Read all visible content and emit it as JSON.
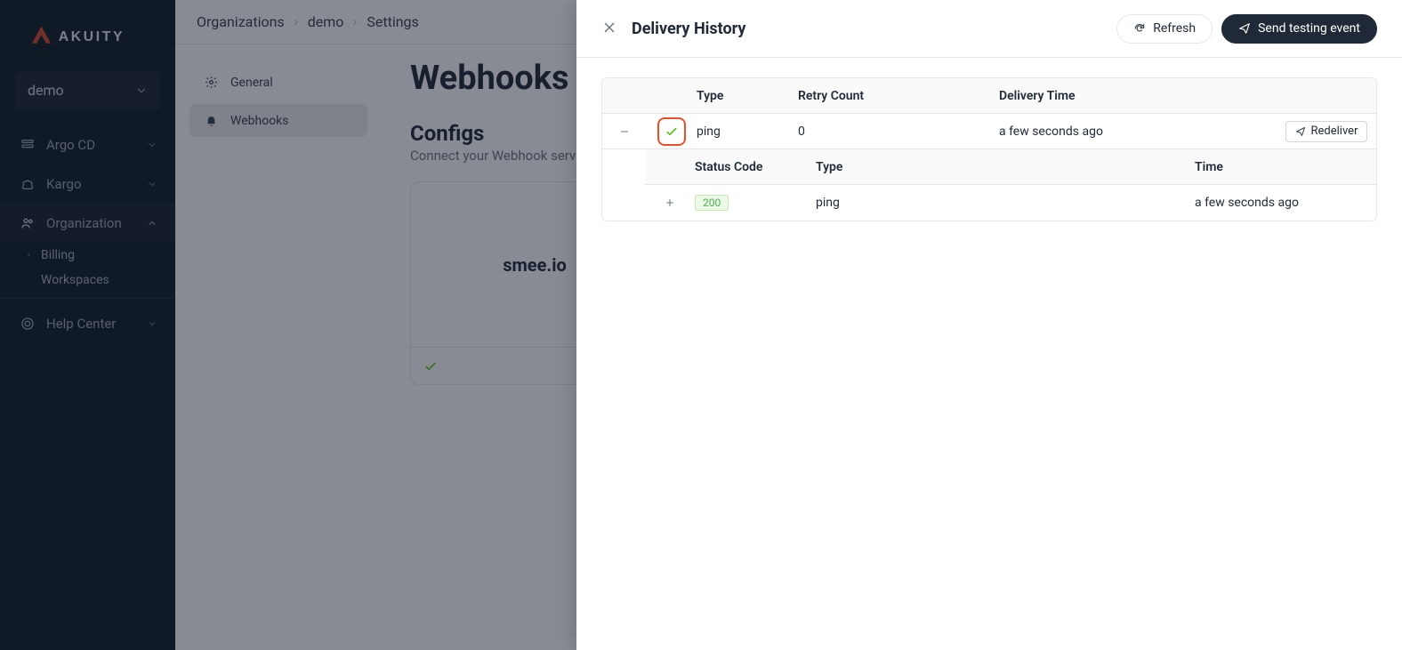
{
  "brand": {
    "name": "AKUITY"
  },
  "org_selector": {
    "current": "demo"
  },
  "sidebar": {
    "items": [
      {
        "label": "Argo CD"
      },
      {
        "label": "Kargo"
      },
      {
        "label": "Organization"
      },
      {
        "label": "Help Center"
      }
    ],
    "org_children": [
      {
        "label": "Billing"
      },
      {
        "label": "Workspaces"
      }
    ]
  },
  "breadcrumb": {
    "seg1": "Organizations",
    "seg2": "demo",
    "seg3": "Settings"
  },
  "sub_nav": {
    "items": [
      {
        "label": "General"
      },
      {
        "label": "Webhooks"
      }
    ]
  },
  "page": {
    "title": "Webhooks",
    "section_heading": "Configs",
    "section_desc": "Connect your Webhook service"
  },
  "card": {
    "name": "smee.io"
  },
  "drawer": {
    "title": "Delivery History",
    "refresh_label": "Refresh",
    "send_test_label": "Send testing event",
    "headers": {
      "type": "Type",
      "retry": "Retry Count",
      "time": "Delivery Time"
    },
    "row": {
      "type": "ping",
      "retry": "0",
      "time": "a few seconds ago",
      "redeliver_label": "Redeliver"
    },
    "sub_headers": {
      "status": "Status Code",
      "type": "Type",
      "time": "Time"
    },
    "sub_row": {
      "status": "200",
      "type": "ping",
      "time": "a few seconds ago"
    }
  }
}
